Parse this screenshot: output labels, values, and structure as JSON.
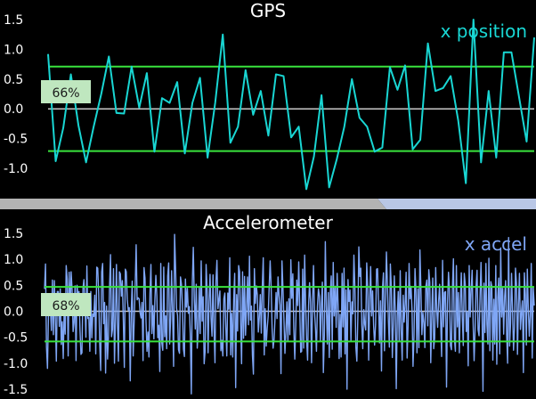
{
  "colors": {
    "background": "#000000",
    "zero_line": "#c8c8c8",
    "threshold_line": "#39e33d",
    "gps_series": "#19d6d3",
    "accel_series": "#7fa6f5",
    "badge_fill": "#bfe7bf",
    "divider_left": "#b3b3b3",
    "divider_right": "#b9c7e6"
  },
  "chart_data": [
    {
      "type": "line",
      "title": "GPS",
      "ylim": [
        -1.35,
        1.6
      ],
      "yticks": [
        "1.5",
        "1.0",
        "0.5",
        "0.0",
        "-0.5",
        "-1.0"
      ],
      "yticks_values": [
        1.5,
        1.0,
        0.5,
        0.0,
        -0.5,
        -1.0
      ],
      "thresholds": [
        0.71,
        -0.71
      ],
      "grid": false,
      "legend": "top-right",
      "badge": "66%",
      "series": [
        {
          "name": "x position",
          "values": [
            0.92,
            -0.88,
            -0.32,
            0.58,
            -0.28,
            -0.9,
            -0.3,
            0.25,
            0.88,
            -0.07,
            -0.08,
            0.71,
            0.02,
            0.6,
            -0.72,
            0.18,
            0.1,
            0.45,
            -0.75,
            0.1,
            0.52,
            -0.82,
            0.1,
            1.25,
            -0.57,
            -0.3,
            0.65,
            -0.1,
            0.3,
            -0.45,
            0.58,
            0.55,
            -0.48,
            -0.3,
            -1.35,
            -0.8,
            0.23,
            -1.32,
            -0.85,
            -0.3,
            0.5,
            -0.15,
            -0.3,
            -0.72,
            -0.65,
            0.7,
            0.32,
            0.73,
            -0.68,
            -0.52,
            1.1,
            0.3,
            0.35,
            0.55,
            -0.2,
            -1.25,
            1.5,
            -0.9,
            0.3,
            -0.82,
            0.95,
            0.95,
            0.2,
            -0.55,
            1.2
          ]
        }
      ]
    },
    {
      "type": "line",
      "title": "Accelerometer",
      "ylim": [
        -1.6,
        1.6
      ],
      "yticks": [
        "1.5",
        "1.0",
        "0.5",
        "0.0",
        "-0.5",
        "-1.0",
        "-1.5"
      ],
      "yticks_values": [
        1.5,
        1.0,
        0.5,
        0.0,
        -0.5,
        -1.0,
        -1.5
      ],
      "thresholds": [
        0.47,
        -0.58
      ],
      "grid": false,
      "legend": "top-right",
      "badge": "68%",
      "series": [
        {
          "name": "x accel",
          "values": [
            0.43,
            0.91,
            -0.69,
            -1.1,
            -0.08,
            0.05,
            0.04,
            -0.37,
            0.6,
            -0.45,
            0.59,
            -0.15,
            -0.96,
            0.38,
            0.38,
            -0.29,
            0.43,
            -0.64,
            -0.2,
            -0.91,
            0.07,
            -0.44,
            0.88,
            0.62,
            -0.86,
            0.75,
            -0.04,
            0.76,
            0.41,
            -0.39,
            -0.22,
            0.49,
            -0.95,
            0.5,
            0.29,
            0.38,
            -0.36,
            -0.83,
            -0.8,
            0.44,
            0.61,
            0.15,
            -0.5,
            0.87,
            -0.14,
            -0.12,
            -0.77,
            0.38,
            -0.51,
            -0.05,
            -0.1,
            0.31,
            -0.82,
            0.85,
            0.83,
            0.33,
            -0.63,
            -1.14,
            0.76,
            0.92,
            -0.24,
            0.17,
            -1.19,
            0.1,
            -0.92,
            -0.46,
            0.49,
            1.09,
            -0.49,
            -0.35,
            0.82,
            -1.0,
            -0.17,
            0.9,
            -0.22,
            -0.96,
            0.76,
            0.72,
            0.29,
            0.59,
            -0.19,
            -1.08,
            0.81,
            0.76,
            0.23,
            0.02,
            0.07,
            -1.34,
            -0.01,
            0.58,
            -0.86,
            -0.2,
            0.48,
            1.28,
            0.22,
            0.26,
            0.24,
            -0.03,
            -0.13,
            0.17,
            -0.95,
            0.84,
            0.64,
            -0.2,
            -0.77,
            -0.4,
            -0.88,
            0.34,
            0.9,
            -0.43,
            0.11,
            -0.53,
            0.21,
            0.69,
            0.29,
            -0.51,
            -0.27,
            -1.16,
            0.92,
            -0.6,
            -0.75,
            0.85,
            -0.49,
            -0.09,
            -0.72,
            0.68,
            0.93,
            -0.63,
            -0.15,
            0.78,
            -0.06,
            -1.06,
            1.48,
            0.85,
            0.06,
            -0.08,
            -0.74,
            -0.81,
            0.66,
            0.52,
            0.1,
            -0.73,
            -0.87,
            0.62,
            0.08,
            0.44,
            -0.04,
            0.09,
            -0.48,
            -1.59,
            0.55,
            1.23,
            0.24,
            -0.34,
            0.52,
            -0.71,
            -0.37,
            0.45,
            -0.43,
            0.97,
            -0.19,
            0.28,
            -1.01,
            -0.77,
            0.9,
            0.42,
            -0.8,
            0.19,
            0.71,
            -0.14,
            -0.48,
            0.7,
            -0.33,
            -0.99,
            0.59,
            0.98,
            0.05,
            0.23,
            0.39,
            -0.76,
            -0.56,
            -0.86,
            0.24,
            0.35,
            -0.3,
            -0.86,
            0.35,
            0.04,
            1.03,
            -0.84,
            -0.04,
            -0.88,
            0.22,
            0.73,
            -1.47,
            0.32,
            -0.38,
            0.88,
            0.76,
            -0.19,
            -1.01,
            0.76,
            -0.52,
            0.67,
            -0.46,
            0.04,
            0.66,
            -0.26,
            1.06,
            -0.17,
            0.1,
            -0.84,
            -1.21,
            0.82,
            0.15,
            0.49,
            0.31,
            -0.4,
            -0.12,
            0.32,
            -0.42,
            0.48,
            1.03,
            -0.84,
            0.05,
            -0.67,
            -0.33,
            -0.09,
            0.46,
            0.97,
            0.48,
            -0.34,
            -0.71,
            -0.54,
            -0.11,
            0.36,
            -0.14,
            0.66,
            0.31,
            0.12,
            -1.2,
            0.97,
            0.44,
            -0.16,
            -0.81,
            -0.38,
            0.18,
            -0.57,
            0.24,
            -0.45,
            0.99,
            0.25,
            0.72,
            -0.33,
            -0.92,
            -0.26,
            0.6,
            0.11,
            0.95,
            0.09,
            -0.79,
            -0.77,
            0.81,
            -0.71,
            1.08,
            0.16,
            -0.55,
            -0.94,
            0.12,
            0.55,
            0.19,
            -0.99,
            0.15,
            0.88,
            0.01,
            -0.33,
            -0.77,
            0.1,
            0.43,
            0.29,
            -0.58,
            0.15,
            0.56,
            -1.18,
            -0.47,
            1.34,
            0.1,
            -0.63,
            0.36,
            -0.89,
            0.35,
            0.68,
            -0.73,
            0.94,
            -0.09,
            0.48,
            -0.31,
            0.73,
            0.09,
            -0.91,
            -0.06,
            -0.88,
            0.73,
            -0.3,
            0.83,
            -0.82,
            0.41,
            -1.5,
            0.61,
            0.19,
            0.41,
            -0.58,
            0.18,
            -0.05,
            1.08,
            0.46,
            -0.7,
            -0.96,
            -0.11,
            1.24,
            0.67,
            0.83,
            -0.27,
            -0.72,
            0.03,
            -0.25,
            -0.36,
            0.93,
            0.48,
            -0.94,
            0.22,
            0.86,
            -0.09,
            0.39,
            -0.27,
            -0.65,
            -0.25,
            0.81,
            0.82,
            0.14,
            -0.61,
            0.2,
            -1.15,
            0.44,
            0.74,
            -0.76,
            0.17,
            1.14,
            0.51,
            -0.18,
            -0.69,
            0.91,
            0.44,
            -0.89,
            -0.26,
            0.68,
            -0.03,
            -1.49,
            -0.09,
            0.38,
            -0.58,
            0.78,
            -0.35,
            -0.94,
            0.31,
            -0.21,
            0.14,
            0.75,
            -0.9,
            -0.27,
            0.92,
            0.24,
            0.48,
            0.02,
            -1.06,
            -0.48,
            0.82,
            0.38,
            -0.8,
            0.43,
            -0.7,
            1.18,
            0.44,
            -0.45,
            -0.02,
            -0.22,
            -0.7,
            0.48,
            0.6,
            -0.28,
            0.8,
            0.55,
            -0.99,
            -0.08,
            0.64,
            -0.72,
            -0.52,
            0.84,
            0.05,
            -0.31,
            0.21,
            0.52,
            -0.18,
            -0.87,
            0.98,
            -0.3,
            0.36,
            0.38,
            -1.46,
            0.14,
            0.75,
            0.41,
            -0.66,
            -0.74,
            0.46,
            1.01,
            -0.53,
            -0.77,
            0.88,
            -0.3,
            0.36,
            -0.8,
            0.14,
            0.74,
            -0.1,
            -0.66,
            0.73,
            0.52,
            -0.39,
            -0.01,
            -1.05,
            0.88,
            -0.11,
            0.41,
            0.79,
            -0.22,
            -0.95,
            -0.36,
            0.49,
            0.79,
            -0.35,
            -0.47,
            0.25,
            0.94,
            0.01,
            -1.54,
            0.54,
            -0.41,
            0.92,
            -0.25,
            -0.63,
            1.02,
            -0.76,
            0.57,
            0.48,
            -0.94,
            0.23,
            -0.63,
            0.88,
            -1.02,
            0.26,
            0.64,
            -0.82,
            1.22,
            -0.11,
            0.44,
            -0.44,
            0.28,
            0.59,
            -0.45,
            -1.0,
            1.42,
            -0.67,
            -0.23,
            0.73,
            0.02,
            -0.75,
            -0.3,
            0.83,
            0.53,
            -0.83,
            0.13,
            0.73,
            -0.35,
            -0.04,
            0.2,
            -1.18,
            0.74,
            0.33,
            -0.65,
            0.81,
            0.06,
            -0.48,
            -0.08,
            0.92,
            -0.9,
            0.46,
            0.11
          ]
        }
      ]
    }
  ]
}
